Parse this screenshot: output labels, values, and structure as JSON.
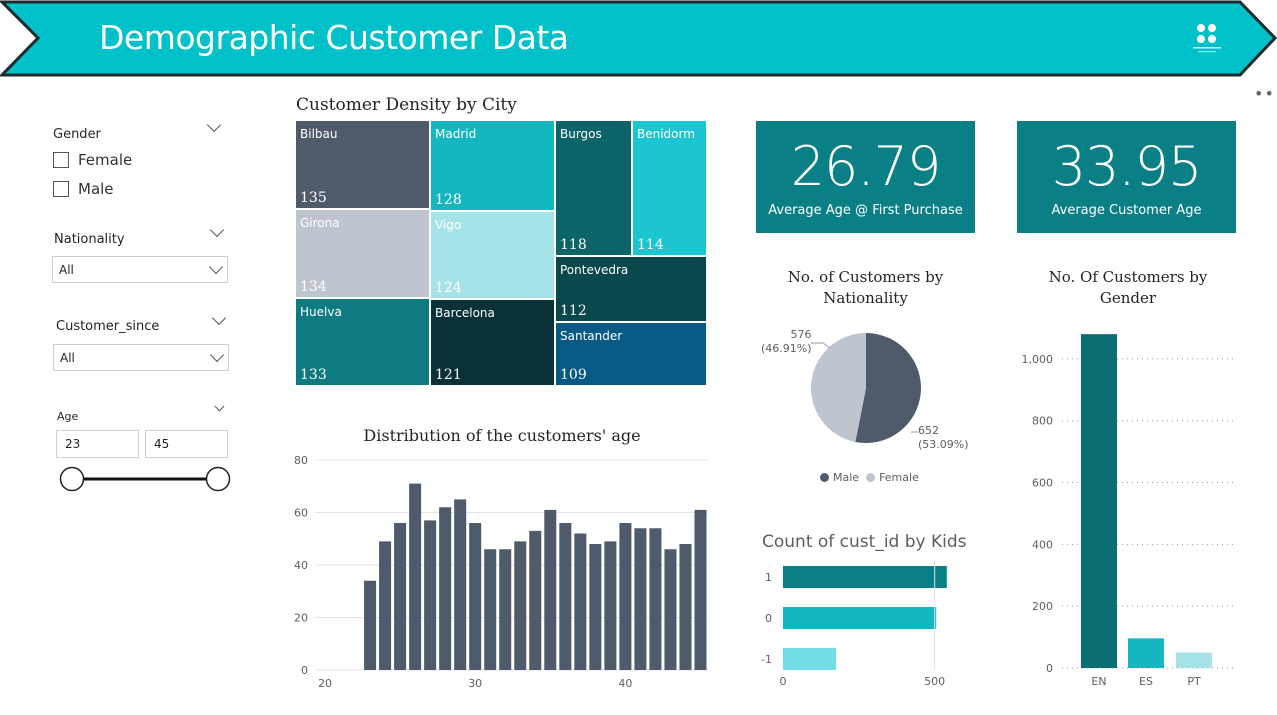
{
  "header": {
    "title": "Demographic Customer Data",
    "banner_color": "#00c0c9",
    "border_color": "#1e2a2b"
  },
  "filters": {
    "gender": {
      "title": "Gender",
      "options": [
        "Female",
        "Male"
      ]
    },
    "nationality": {
      "title": "Nationality",
      "value": "All"
    },
    "customer_since": {
      "title": "Customer_since",
      "value": "All"
    },
    "age": {
      "title": "Age",
      "min": "23",
      "max": "45"
    }
  },
  "treemap": {
    "title": "Customer Density by City",
    "cells": [
      {
        "name": "Bilbau",
        "value": "135",
        "color": "#4f5b6b"
      },
      {
        "name": "Girona",
        "value": "134",
        "color": "#bec5ce"
      },
      {
        "name": "Huelva",
        "value": "133",
        "color": "#0e7b80"
      },
      {
        "name": "Madrid",
        "value": "128",
        "color": "#14b6c0"
      },
      {
        "name": "Vigo",
        "value": "124",
        "color": "#a6e3e8"
      },
      {
        "name": "Barcelona",
        "value": "121",
        "color": "#0a3137"
      },
      {
        "name": "Burgos",
        "value": "118",
        "color": "#0c6468"
      },
      {
        "name": "Benidorm",
        "value": "114",
        "color": "#1bc6d1"
      },
      {
        "name": "Pontevedra",
        "value": "112",
        "color": "#09484d"
      },
      {
        "name": "Santander",
        "value": "109",
        "color": "#075a86"
      }
    ]
  },
  "kpis": [
    {
      "value": "26.79",
      "label": "Average Age @ First Purchase"
    },
    {
      "value": "33.95",
      "label": "Average Customer Age"
    }
  ],
  "pie": {
    "title_line1": "No. of Customers by",
    "title_line2": "Nationality",
    "slices": [
      {
        "name": "Male",
        "value": 652,
        "pct": "(53.09%)",
        "color": "#4f5b6b"
      },
      {
        "name": "Female",
        "value": 576,
        "pct": "(46.91%)",
        "color": "#bec5ce"
      }
    ],
    "label_male_value": "652",
    "label_male_pct": "(53.09%)",
    "label_female_value": "576",
    "label_female_pct": "(46.91%)",
    "legend_male": "Male",
    "legend_female": "Female"
  },
  "chart_data": [
    {
      "type": "bar",
      "title": "Distribution of the customers' age",
      "x": [
        23,
        24,
        25,
        26,
        27,
        28,
        29,
        30,
        31,
        32,
        33,
        34,
        35,
        36,
        37,
        38,
        39,
        40,
        41,
        42,
        43,
        44,
        45
      ],
      "values": [
        34,
        49,
        56,
        71,
        57,
        62,
        65,
        56,
        46,
        46,
        49,
        53,
        61,
        56,
        52,
        48,
        49,
        56,
        54,
        54,
        46,
        48,
        61
      ],
      "xlim": [
        20,
        45
      ],
      "ylim": [
        0,
        80
      ],
      "x_ticks": [
        20,
        30,
        40
      ],
      "y_ticks": [
        0,
        20,
        40,
        60,
        80
      ],
      "color": "#4f5b6b"
    },
    {
      "type": "bar",
      "orientation": "horizontal",
      "title": "Count of cust_id by Kids",
      "categories": [
        "1",
        "0",
        "-1"
      ],
      "values": [
        540,
        505,
        175
      ],
      "colors": [
        "#0b7f86",
        "#14b6c0",
        "#72dde6"
      ],
      "xlim": [
        0,
        600
      ],
      "x_ticks": [
        0,
        500
      ]
    },
    {
      "type": "bar",
      "title_line1": "No. Of Customers by",
      "title_line2": "Gender",
      "categories": [
        "EN",
        "ES",
        "PT"
      ],
      "values": [
        1080,
        96,
        50
      ],
      "colors": [
        "#0b6e72",
        "#14b6c0",
        "#a6e3e8"
      ],
      "ylim": [
        0,
        1100
      ],
      "y_ticks": [
        0,
        200,
        400,
        600,
        800,
        1000
      ],
      "y_tick_labels": [
        "0",
        "200",
        "400",
        "600",
        "800",
        "1,000"
      ]
    }
  ]
}
